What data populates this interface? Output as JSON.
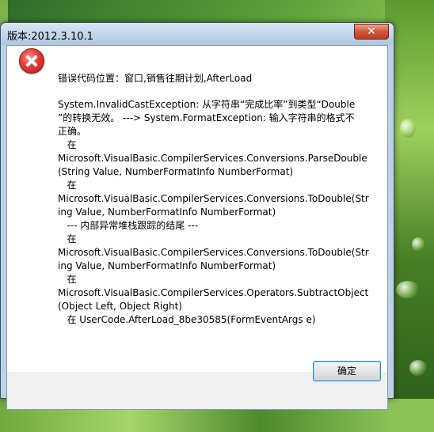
{
  "window": {
    "title": "版本:2012.3.10.1",
    "close_glyph": "✕"
  },
  "message": {
    "heading": "错误代码位置：窗口,销售往期计划,AfterLoad",
    "lines": [
      "System.InvalidCastException: 从字符串“完成比率”到类型“Double",
      "”的转换无效。 ---> System.FormatException: 输入字符串的格式不",
      "正确。",
      "   在",
      "Microsoft.VisualBasic.CompilerServices.Conversions.ParseDouble",
      "(String Value, NumberFormatInfo NumberFormat)",
      "   在",
      "Microsoft.VisualBasic.CompilerServices.Conversions.ToDouble(Str",
      "ing Value, NumberFormatInfo NumberFormat)",
      "   --- 内部异常堆栈跟踪的结尾 ---",
      "   在",
      "Microsoft.VisualBasic.CompilerServices.Conversions.ToDouble(Str",
      "ing Value, NumberFormatInfo NumberFormat)",
      "   在",
      "Microsoft.VisualBasic.CompilerServices.Operators.SubtractObject",
      "(Object Left, Object Right)",
      "   在 UserCode.AfterLoad_8be30585(FormEventArgs e)"
    ]
  },
  "buttons": {
    "ok_label": "确定"
  },
  "icons": {
    "error": "error-icon",
    "close": "close-icon"
  },
  "colors": {
    "title_bar": "#c3d6ea",
    "close_button": "#c13b22",
    "error_red": "#e53935",
    "ok_border": "#2f86c9"
  }
}
